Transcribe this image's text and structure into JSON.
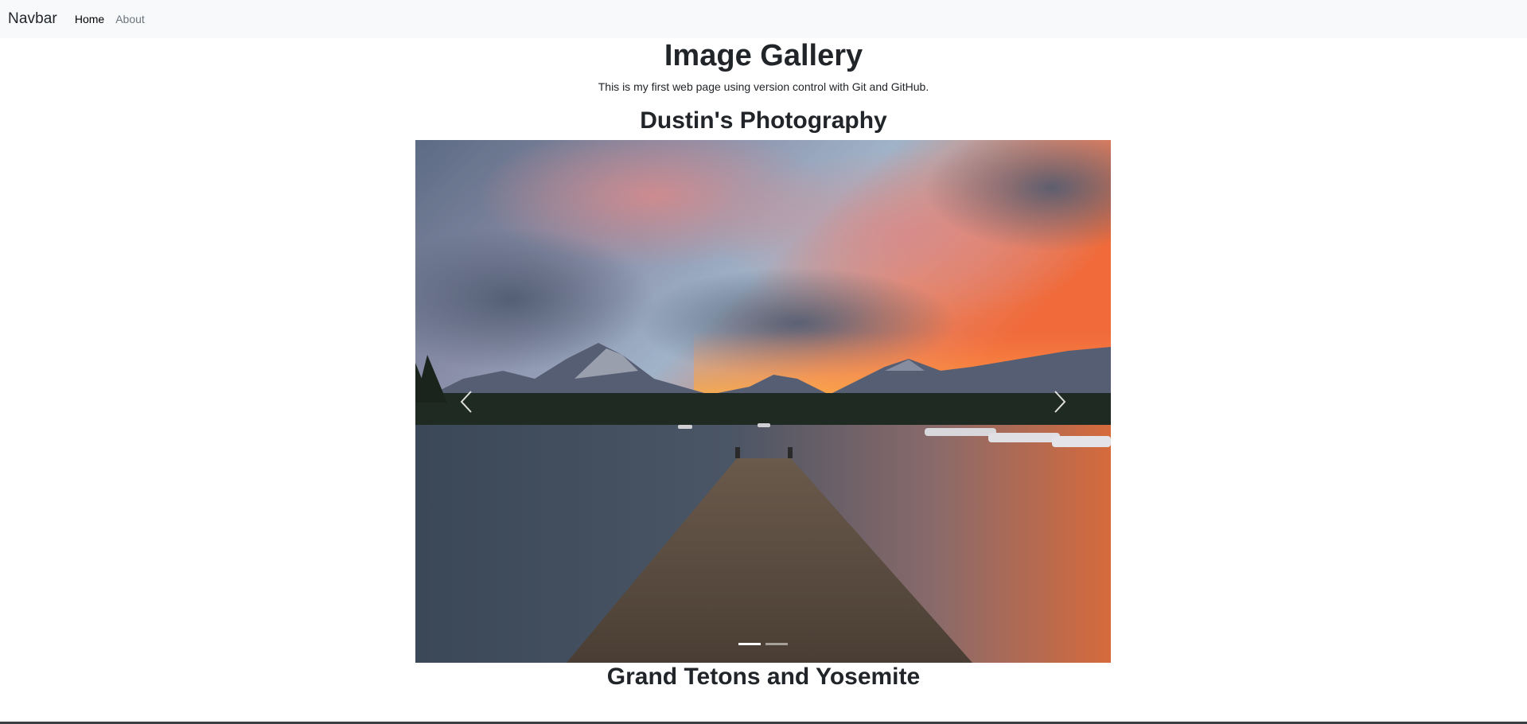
{
  "navbar": {
    "brand": "Navbar",
    "links": [
      {
        "label": "Home",
        "active": true
      },
      {
        "label": "About",
        "active": false
      }
    ]
  },
  "header": {
    "title": "Image Gallery",
    "subtitle": "This is my first web page using version control with Git and GitHub."
  },
  "gallery": {
    "heading": "Dustin's Photography",
    "slide_count": 2,
    "active_slide": 1,
    "caption_heading": "Grand Tetons and Yosemite"
  },
  "colors": {
    "navbar_bg": "#f8f9fa",
    "text": "#212529",
    "muted_link": "#6c757d"
  },
  "icons": {
    "prev": "chevron-left-icon",
    "next": "chevron-right-icon"
  }
}
